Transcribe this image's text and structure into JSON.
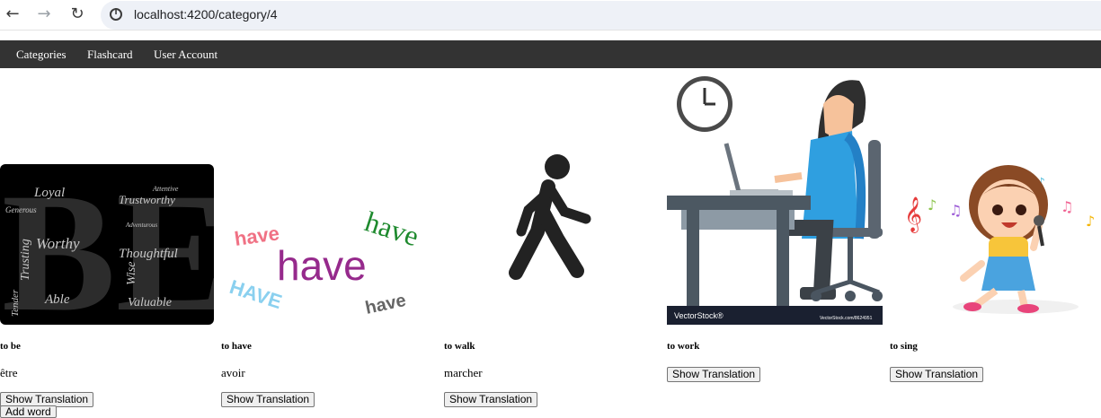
{
  "browser": {
    "url": "localhost:4200/category/4"
  },
  "navbar": {
    "items": [
      "Categories",
      "Flashcard",
      "User Account"
    ]
  },
  "cards": [
    {
      "word": "to be",
      "translation": "être",
      "button": "Show Translation",
      "image_words": [
        "Loyal",
        "Trustworthy",
        "Worthy",
        "Thoughtful",
        "Wise",
        "Able",
        "Valuable",
        "Trusting",
        "Generous",
        "Tender",
        "Adventurous",
        "Attentive"
      ]
    },
    {
      "word": "to have",
      "translation": "avoir",
      "button": "Show Translation",
      "image_words": [
        "have",
        "have",
        "have",
        "HAVE",
        "have"
      ]
    },
    {
      "word": "to walk",
      "translation": "marcher",
      "button": "Show Translation"
    },
    {
      "word": "to work",
      "translation": "",
      "button": "Show Translation",
      "image_words": [
        "VectorStock®",
        "VectorStock.com/8624951"
      ]
    },
    {
      "word": "to sing",
      "translation": "",
      "button": "Show Translation"
    }
  ],
  "add_button": "Add word",
  "colors": {
    "navbar": "#333333",
    "omnibox": "#eef1f7"
  }
}
